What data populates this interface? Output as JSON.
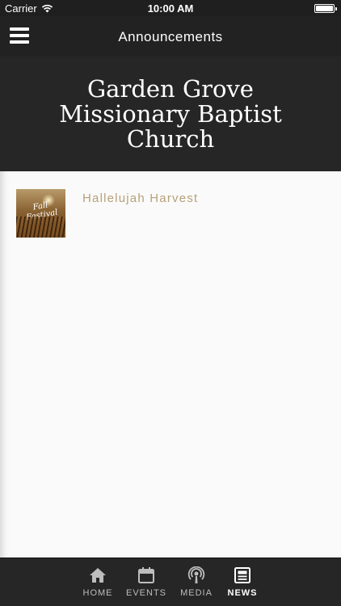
{
  "status_bar": {
    "carrier": "Carrier",
    "time": "10:00 AM"
  },
  "nav": {
    "title": "Announcements",
    "menu_icon": "hamburger-menu-icon"
  },
  "hero": {
    "church_name": "Garden Grove Missionary Baptist Church"
  },
  "news": {
    "items": [
      {
        "title": "Hallelujah Harvest",
        "thumbnail_text": "Fall Festival"
      }
    ]
  },
  "tabs": [
    {
      "label": "HOME",
      "icon": "home-icon",
      "active": false
    },
    {
      "label": "EVENTS",
      "icon": "calendar-icon",
      "active": false
    },
    {
      "label": "MEDIA",
      "icon": "podcast-icon",
      "active": false
    },
    {
      "label": "NEWS",
      "icon": "newspaper-icon",
      "active": true
    }
  ],
  "colors": {
    "bars": "#222222",
    "hero_bg": "#262626",
    "content_bg": "#fafafa",
    "headline": "#b8a078"
  }
}
